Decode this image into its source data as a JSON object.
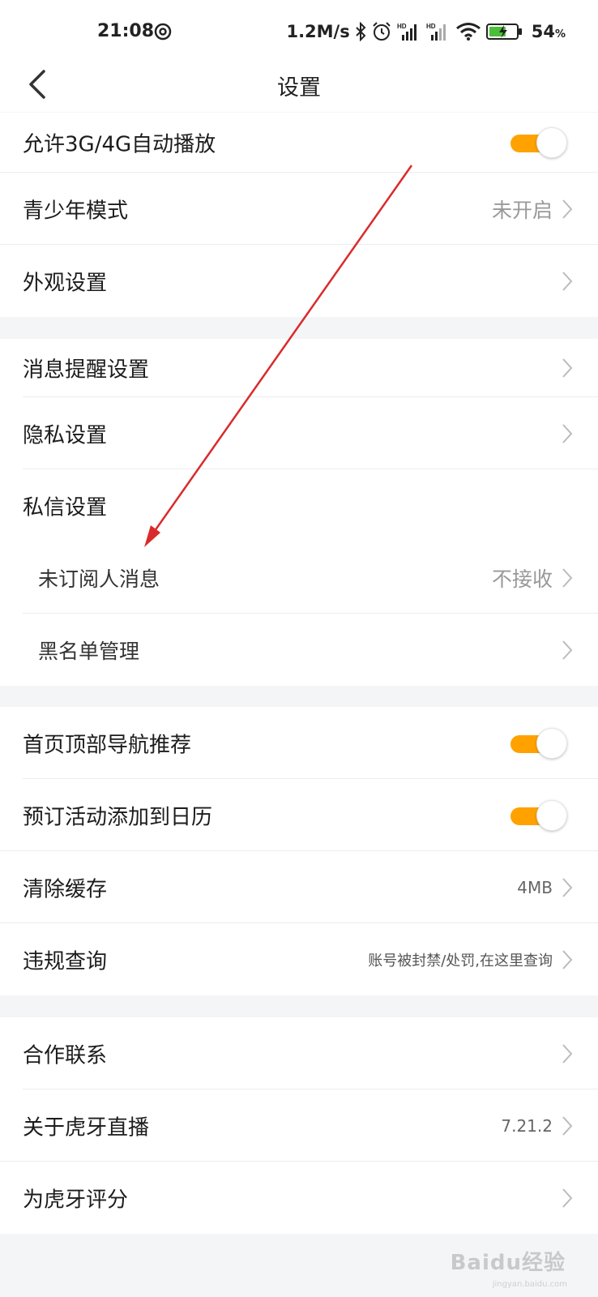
{
  "status_bar": {
    "time": "21:08",
    "network_speed": "1.2M/s",
    "battery_percent": "54",
    "battery_symbol": "%",
    "icons": [
      "at-icon",
      "bluetooth-icon",
      "alarm-icon",
      "hd-signal-icon",
      "hd-signal-icon",
      "wifi-icon",
      "battery-charging-icon"
    ]
  },
  "nav": {
    "title": "设置",
    "back_icon": "chevron-left-icon"
  },
  "groups": [
    {
      "rows": [
        {
          "label": "允许3G/4G自动播放",
          "type": "toggle",
          "on": true
        },
        {
          "label": "青少年模式",
          "type": "link",
          "value": "未开启"
        },
        {
          "label": "外观设置",
          "type": "link"
        }
      ]
    },
    {
      "rows": [
        {
          "label": "消息提醒设置",
          "type": "link"
        },
        {
          "label": "隐私设置",
          "type": "link"
        },
        {
          "label": "私信设置",
          "type": "header"
        },
        {
          "label": "未订阅人消息",
          "type": "link",
          "value": "不接收",
          "sub": true
        },
        {
          "label": "黑名单管理",
          "type": "link",
          "sub": true
        }
      ]
    },
    {
      "rows": [
        {
          "label": "首页顶部导航推荐",
          "type": "toggle",
          "on": true
        },
        {
          "label": "预订活动添加到日历",
          "type": "toggle",
          "on": true
        },
        {
          "label": "清除缓存",
          "type": "link",
          "value": "4MB"
        },
        {
          "label": "违规查询",
          "type": "link",
          "value": "账号被封禁/处罚,在这里查询"
        }
      ]
    },
    {
      "rows": [
        {
          "label": "合作联系",
          "type": "link"
        },
        {
          "label": "关于虎牙直播",
          "type": "link",
          "value": "7.21.2"
        },
        {
          "label": "为虎牙评分",
          "type": "link"
        }
      ]
    }
  ],
  "watermark": {
    "text": "Baidu经验",
    "sub": "jingyan.baidu.com"
  },
  "colors": {
    "accent": "#ffa200",
    "arrow": "#d92b2b",
    "background": "#f4f5f7"
  }
}
